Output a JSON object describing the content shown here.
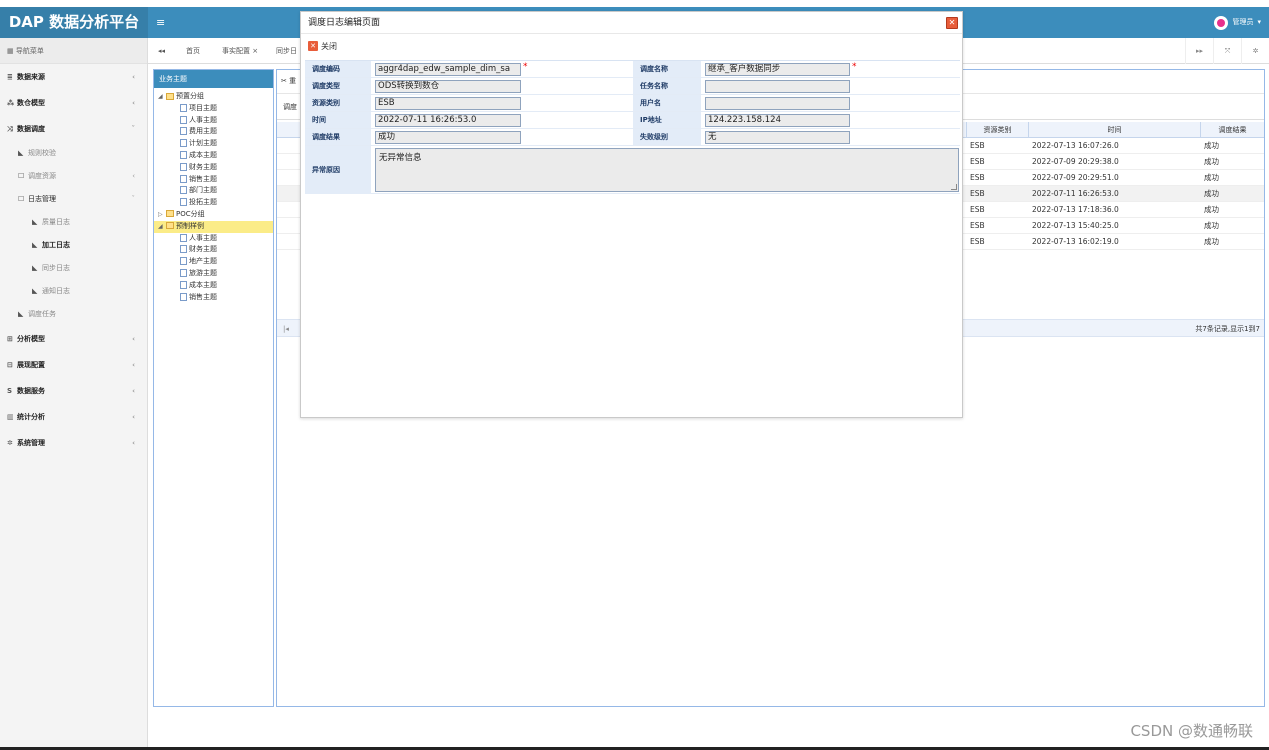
{
  "app": {
    "title": "DAP 数据分析平台",
    "user": "管理员"
  },
  "sidebar": {
    "header": "导航菜单",
    "items": [
      {
        "label": "数据来源"
      },
      {
        "label": "数仓模型"
      },
      {
        "label": "数据调度"
      },
      {
        "label": "规则校验"
      },
      {
        "label": "调度资源"
      },
      {
        "label": "日志管理"
      },
      {
        "label": "质量日志"
      },
      {
        "label": "加工日志"
      },
      {
        "label": "同步日志"
      },
      {
        "label": "通知日志"
      },
      {
        "label": "调度任务"
      },
      {
        "label": "分析模型"
      },
      {
        "label": "展现配置"
      },
      {
        "label": "数据服务"
      },
      {
        "label": "统计分析"
      },
      {
        "label": "系统管理"
      }
    ]
  },
  "tabs": [
    {
      "label": "首页"
    },
    {
      "label": "事实配置 ×"
    },
    {
      "label": "同步日"
    }
  ],
  "tree": {
    "title": "业务主题",
    "nodes": [
      {
        "label": "预置分组"
      },
      {
        "label": "项目主题"
      },
      {
        "label": "人事主题"
      },
      {
        "label": "费用主题"
      },
      {
        "label": "计划主题"
      },
      {
        "label": "成本主题"
      },
      {
        "label": "财务主题"
      },
      {
        "label": "销售主题"
      },
      {
        "label": "部门主题"
      },
      {
        "label": "投拓主题"
      },
      {
        "label": "POC分组"
      },
      {
        "label": "预制样例"
      },
      {
        "label": "人事主题"
      },
      {
        "label": "财务主题"
      },
      {
        "label": "地产主题"
      },
      {
        "label": "旅游主题"
      },
      {
        "label": "成本主题"
      },
      {
        "label": "销售主题"
      }
    ]
  },
  "grid": {
    "toolbar_label": "重",
    "query_label": "调度",
    "columns": [
      "资源类别",
      "时间",
      "调度结果"
    ],
    "rows": [
      {
        "type": "ESB",
        "time": "2022-07-13 16:07:26.0",
        "result": "成功"
      },
      {
        "type": "ESB",
        "time": "2022-07-09 20:29:38.0",
        "result": "成功"
      },
      {
        "type": "ESB",
        "time": "2022-07-09 20:29:51.0",
        "result": "成功"
      },
      {
        "type": "ESB",
        "time": "2022-07-11 16:26:53.0",
        "result": "成功"
      },
      {
        "type": "ESB",
        "time": "2022-07-13 17:18:36.0",
        "result": "成功"
      },
      {
        "type": "ESB",
        "time": "2022-07-13 15:40:25.0",
        "result": "成功"
      },
      {
        "type": "ESB",
        "time": "2022-07-13 16:02:19.0",
        "result": "成功"
      }
    ],
    "pager_info": "共7条记录,显示1到7"
  },
  "dialog": {
    "title": "调度日志编辑页面",
    "close_label": "关闭",
    "fields": {
      "code_label": "调度编码",
      "code_value": "aggr4dap_edw_sample_dim_sa",
      "name_label": "调度名称",
      "name_value": "继承_客户数据同步",
      "type_label": "调度类型",
      "type_value": "ODS转换到数仓",
      "task_label": "任务名称",
      "task_value": "",
      "res_label": "资源类别",
      "res_value": "ESB",
      "user_label": "用户名",
      "user_value": "",
      "time_label": "时间",
      "time_value": "2022-07-11 16:26:53.0",
      "ip_label": "IP地址",
      "ip_value": "124.223.158.124",
      "result_label": "调度结果",
      "result_value": "成功",
      "fail_label": "失败级别",
      "fail_value": "无",
      "err_label": "异常原因",
      "err_value": "无异常信息"
    }
  },
  "watermark": "CSDN @数通畅联"
}
